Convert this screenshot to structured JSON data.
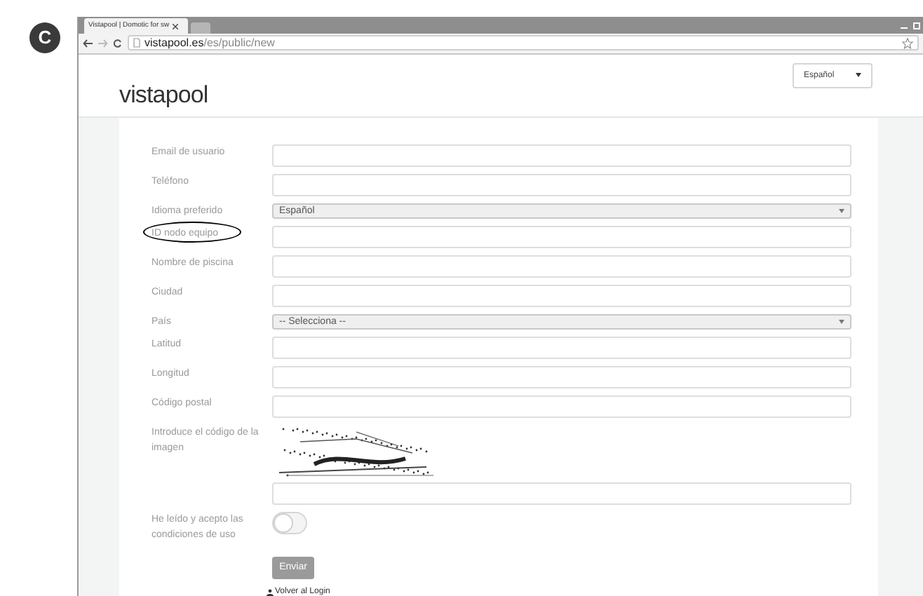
{
  "figure_label": "C",
  "browser": {
    "tab_title": "Vistapool | Domotic for sw",
    "url_host": "vistapool.es",
    "url_path": "/es/public/new"
  },
  "header": {
    "logo": "vistapool",
    "language": "Español"
  },
  "fields": [
    {
      "kind": "input",
      "label": "Email de usuario",
      "circled": false
    },
    {
      "kind": "input",
      "label": "Teléfono",
      "circled": false
    },
    {
      "kind": "select",
      "label": "Idioma preferido",
      "value": "Español",
      "circled": false
    },
    {
      "kind": "input",
      "label": "ID nodo equipo",
      "circled": true
    },
    {
      "kind": "input",
      "label": "Nombre de piscina",
      "circled": false
    },
    {
      "kind": "input",
      "label": "Ciudad",
      "circled": false
    },
    {
      "kind": "select",
      "label": "País",
      "value": "-- Selecciona --",
      "circled": false
    },
    {
      "kind": "input",
      "label": "Latitud",
      "circled": false
    },
    {
      "kind": "input",
      "label": "Longitud",
      "circled": false
    },
    {
      "kind": "input",
      "label": "Código postal",
      "circled": false
    },
    {
      "kind": "captcha",
      "label": "Introduce el código de la imagen",
      "circled": false
    },
    {
      "kind": "toggle",
      "label": "He leído y acepto las condiciones de uso",
      "on": false,
      "circled": false
    }
  ],
  "submit": "Enviar",
  "back_link": "Volver al Login"
}
